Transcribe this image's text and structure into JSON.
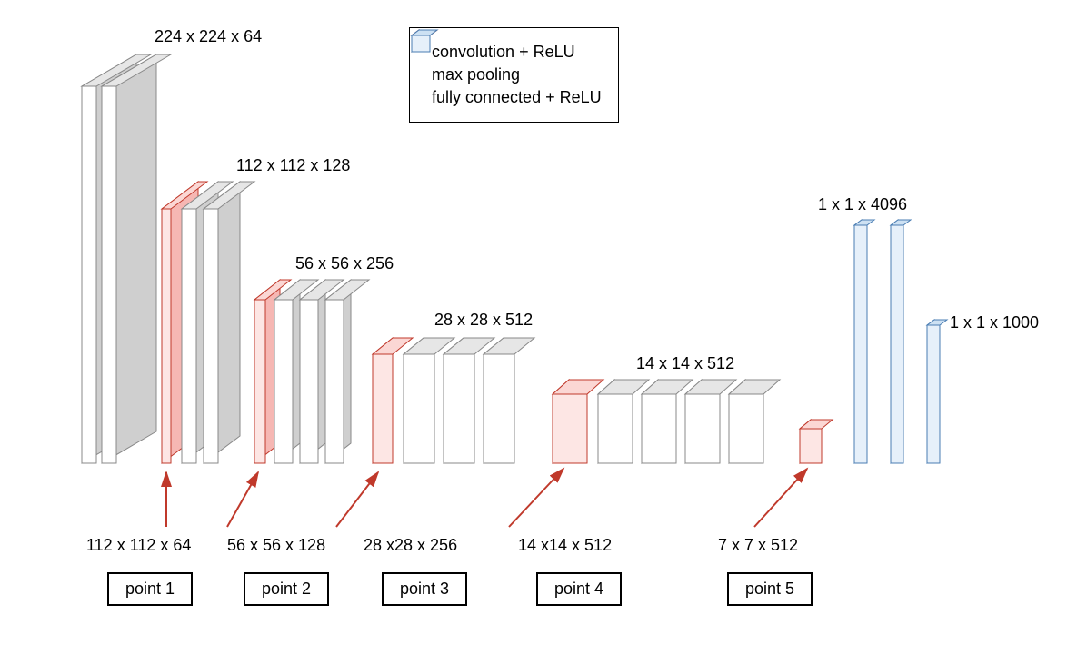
{
  "labels": {
    "top1": "224 x 224 x 64",
    "top2": "112 x 112 x 128",
    "top3": "56 x 56 x 256",
    "top4": "28 x 28 x 512",
    "top5": "14 x 14 x 512",
    "fc1": "1 x 1 x 4096",
    "fc2": "1 x 1 x 1000",
    "pool1": "112 x 112 x 64",
    "pool2": "56 x 56 x 128",
    "pool3": "28 x28 x 256",
    "pool4": "14 x14 x 512",
    "pool5": "7 x 7 x 512"
  },
  "points": {
    "p1": "point 1",
    "p2": "point 2",
    "p3": "point 3",
    "p4": "point 4",
    "p5": "point 5"
  },
  "legend": {
    "conv": "convolution + ReLU",
    "pool": "max pooling",
    "fc": "fully connected + ReLU"
  }
}
